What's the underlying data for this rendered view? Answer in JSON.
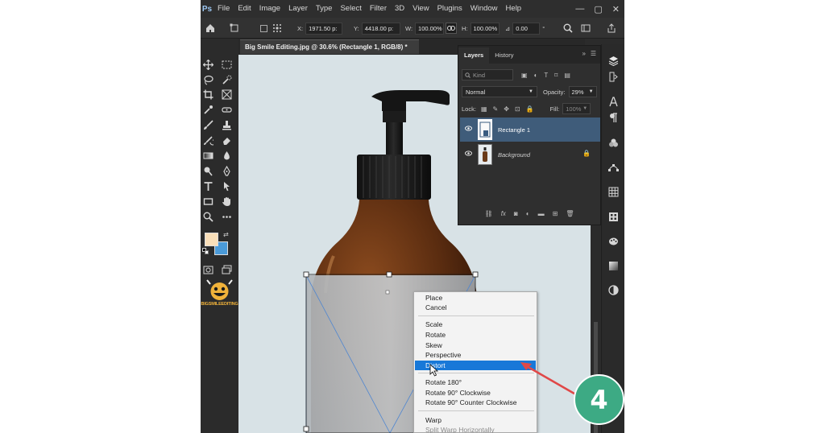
{
  "app": {
    "logo_text": "Ps"
  },
  "menu": [
    "File",
    "Edit",
    "Image",
    "Layer",
    "Type",
    "Select",
    "Filter",
    "3D",
    "View",
    "Plugins",
    "Window",
    "Help"
  ],
  "options": {
    "x_label": "X:",
    "x_value": "1971.50 p:",
    "y_label": "Y:",
    "y_value": "4418.00 p:",
    "w_label": "W:",
    "w_value": "100.00%",
    "h_label": "H:",
    "h_value": "100.00%",
    "angle_label": "⊿",
    "angle_value": "0.00",
    "angle_unit": "°"
  },
  "document_tab": "Big Smile Editing.jpg @ 30.6% (Rectangle 1, RGB/8) *",
  "colors": {
    "foreground": "#f9dfb9",
    "background": "#4a9ad8",
    "highlight": "#1878d8",
    "badge": "#3daa84",
    "arrow": "#e04848"
  },
  "brand_logo_text": "BIGSMILEEDITING",
  "layers_panel": {
    "tabs": [
      "Layers",
      "History"
    ],
    "kind_placeholder": "Kind",
    "blend_mode": "Normal",
    "opacity_label": "Opacity:",
    "opacity_value": "29%",
    "lock_label": "Lock:",
    "fill_label": "Fill:",
    "fill_value": "100%",
    "layers": [
      {
        "name": "Rectangle 1",
        "selected": true
      },
      {
        "name": "Background",
        "selected": false,
        "locked": true
      }
    ]
  },
  "context_menu": {
    "groups": [
      [
        "Place",
        "Cancel"
      ],
      [
        "Scale",
        "Rotate",
        "Skew",
        "Perspective",
        "Distort"
      ],
      [
        "Rotate 180°",
        "Rotate 90° Clockwise",
        "Rotate 90° Counter Clockwise"
      ],
      [
        "Warp",
        "Split Warp Horizontally"
      ]
    ],
    "highlighted": "Distort"
  },
  "step_badge": "4"
}
